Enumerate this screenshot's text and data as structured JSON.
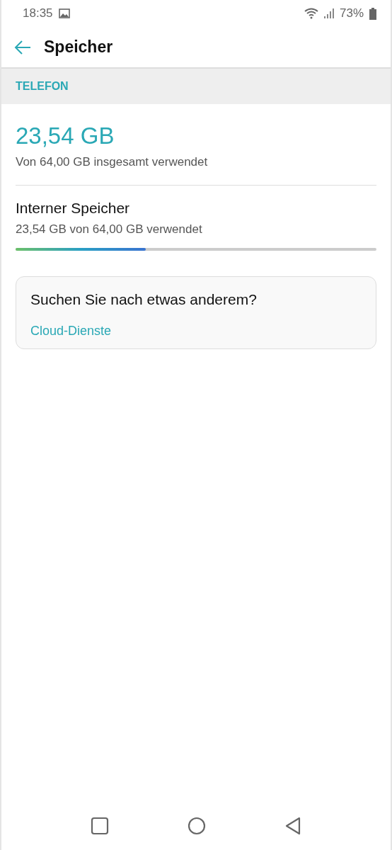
{
  "status_bar": {
    "time": "18:35",
    "battery": "73%"
  },
  "app_bar": {
    "title": "Speicher"
  },
  "section": {
    "title": "TELEFON"
  },
  "total": {
    "used": "23,54 GB",
    "caption": "Von 64,00 GB insgesamt verwendet"
  },
  "storage_items": [
    {
      "name": "Interner Speicher",
      "detail": "23,54 GB von 64,00 GB verwendet",
      "level": 0.36
    }
  ],
  "card": {
    "question": "Suchen Sie nach etwas anderem?",
    "link": "Cloud-Dienste"
  }
}
